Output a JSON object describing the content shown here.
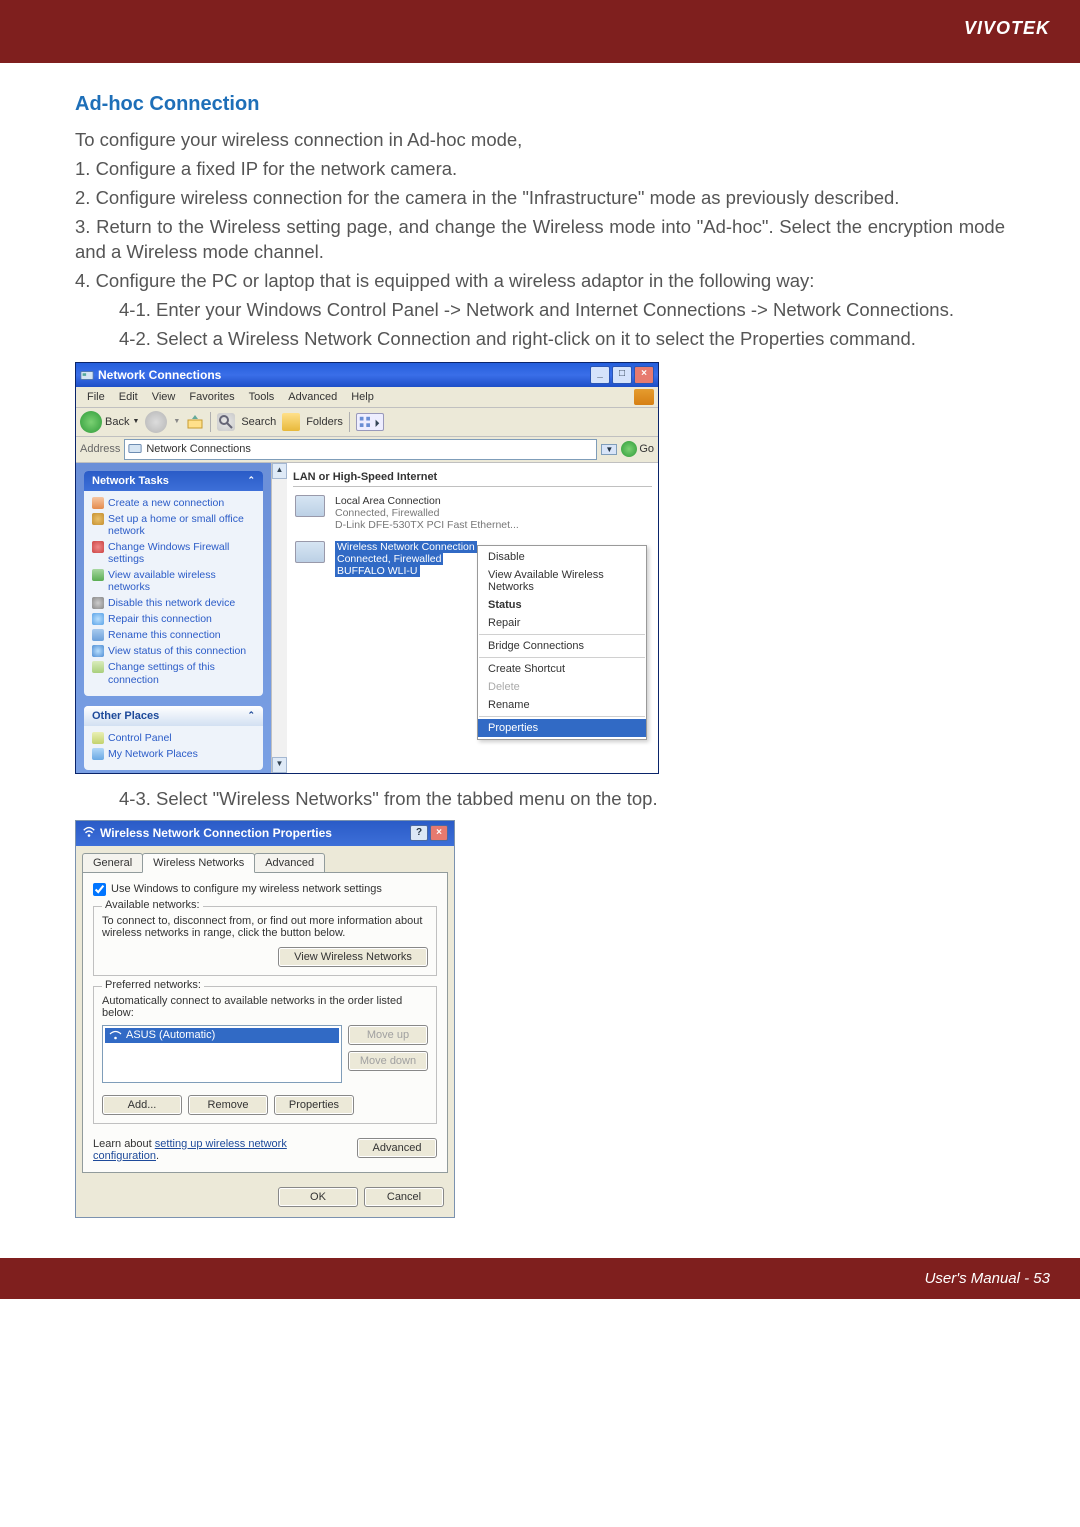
{
  "header": {
    "brand": "VIVOTEK"
  },
  "section": {
    "title": "Ad-hoc Connection",
    "intro": "To configure your wireless connection in Ad-hoc mode,",
    "steps": [
      "1. Configure a fixed IP for the network camera.",
      "2. Configure wireless connection for the camera in the \"Infrastructure\" mode as previously described.",
      "3. Return to the Wireless setting page, and change the Wireless mode into \"Ad-hoc\". Select the encryption mode and a Wireless mode channel.",
      "4. Configure the PC or laptop that is equipped with a wireless adaptor in the following way:"
    ],
    "substeps": [
      "4-1. Enter your Windows Control Panel -> Network and Internet Connections -> Network Connections.",
      "4-2. Select a Wireless Network Connection and right-click on it to select the Properties command.",
      "4-3. Select \"Wireless Networks\" from the tabbed menu on the top."
    ]
  },
  "nc_window": {
    "title": "Network Connections",
    "menus": [
      "File",
      "Edit",
      "View",
      "Favorites",
      "Tools",
      "Advanced",
      "Help"
    ],
    "toolbar": {
      "back": "Back",
      "search": "Search",
      "folders": "Folders"
    },
    "address": {
      "label": "Address",
      "value": "Network Connections",
      "go": "Go"
    },
    "sidebar": {
      "network_tasks": {
        "title": "Network Tasks",
        "links": [
          "Create a new connection",
          "Set up a home or small office network",
          "Change Windows Firewall settings",
          "View available wireless networks",
          "Disable this network device",
          "Repair this connection",
          "Rename this connection",
          "View status of this connection",
          "Change settings of this connection"
        ]
      },
      "other_places": {
        "title": "Other Places",
        "links": [
          "Control Panel",
          "My Network Places"
        ]
      }
    },
    "main": {
      "category": "LAN or High-Speed Internet",
      "lac": {
        "name": "Local Area Connection",
        "status": "Connected, Firewalled",
        "device": "D-Link DFE-530TX PCI Fast Ethernet..."
      },
      "wnc": {
        "name": "Wireless Network Connection",
        "status": "Connected, Firewalled",
        "device": "BUFFALO WLI-U"
      }
    },
    "context_menu": {
      "disable": "Disable",
      "view_available": "View Available Wireless Networks",
      "status": "Status",
      "repair": "Repair",
      "bridge": "Bridge Connections",
      "shortcut": "Create Shortcut",
      "delete": "Delete",
      "rename": "Rename",
      "properties": "Properties"
    }
  },
  "wcn_dialog": {
    "title": "Wireless Network Connection Properties",
    "tabs": {
      "general": "General",
      "wireless": "Wireless Networks",
      "advanced": "Advanced"
    },
    "use_windows": "Use Windows to configure my wireless network settings",
    "available": {
      "legend": "Available networks:",
      "desc": "To connect to, disconnect from, or find out more information about wireless networks in range, click the button below.",
      "button": "View Wireless Networks"
    },
    "preferred": {
      "legend": "Preferred networks:",
      "desc": "Automatically connect to available networks in the order listed below:",
      "item": "ASUS (Automatic)",
      "move_up": "Move up",
      "move_down": "Move down",
      "add": "Add...",
      "remove": "Remove",
      "properties": "Properties"
    },
    "learn_before": "Learn about ",
    "learn_link": "setting up wireless network configuration",
    "learn_after": ".",
    "advanced_btn": "Advanced",
    "ok": "OK",
    "cancel": "Cancel"
  },
  "footer": {
    "text": "User's Manual - 53"
  }
}
